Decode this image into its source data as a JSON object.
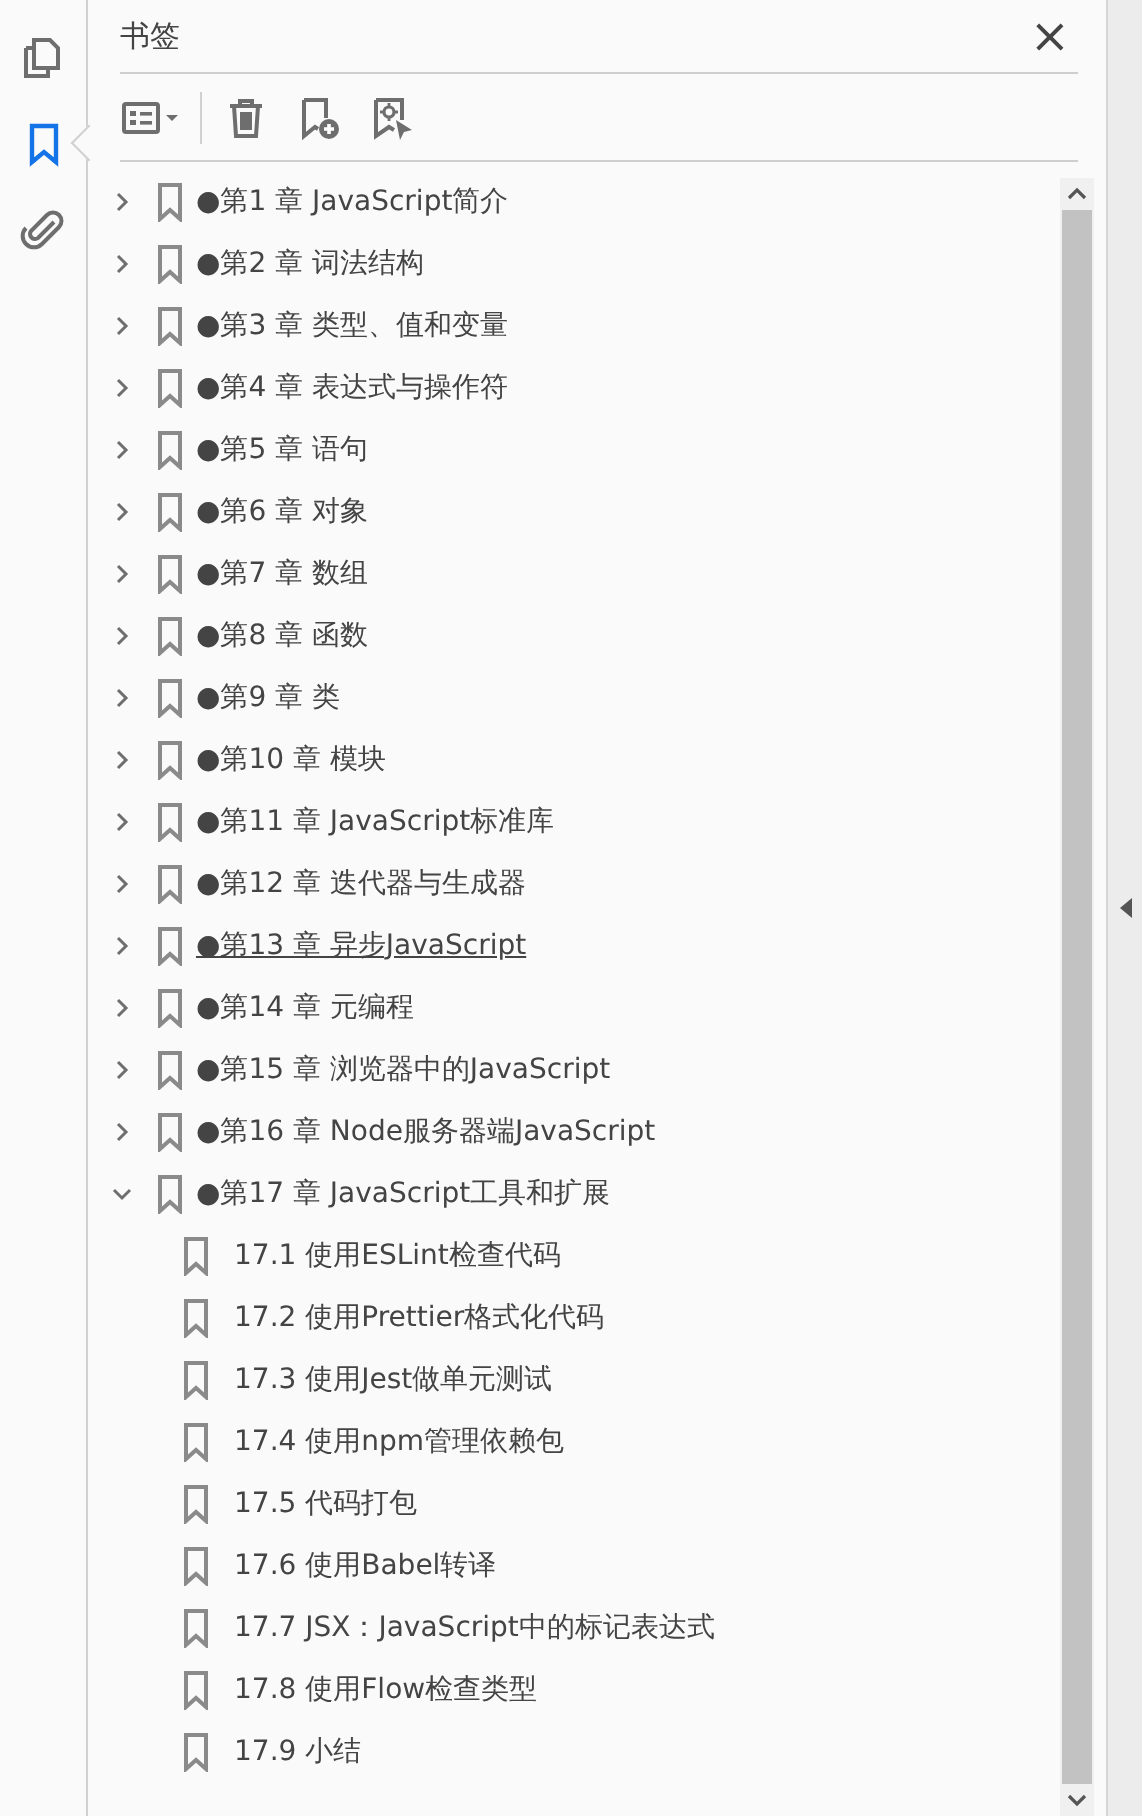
{
  "rail": [
    {
      "kind": "pages",
      "selected": false
    },
    {
      "kind": "bookmarks",
      "selected": true
    },
    {
      "kind": "attachments",
      "selected": false
    }
  ],
  "panel": {
    "title": "书签",
    "close": "×"
  },
  "toolbar": [
    {
      "kind": "options"
    },
    {
      "kind": "delete"
    },
    {
      "kind": "new"
    },
    {
      "kind": "from-selection"
    }
  ],
  "bookmarks": [
    {
      "label": "●第1 章 JavaScript简介",
      "expanded": false,
      "hovered": false
    },
    {
      "label": "●第2 章 词法结构",
      "expanded": false,
      "hovered": false
    },
    {
      "label": "●第3 章 类型、值和变量",
      "expanded": false,
      "hovered": false
    },
    {
      "label": "●第4 章 表达式与操作符",
      "expanded": false,
      "hovered": false
    },
    {
      "label": "●第5 章 语句",
      "expanded": false,
      "hovered": false
    },
    {
      "label": "●第6 章 对象",
      "expanded": false,
      "hovered": false
    },
    {
      "label": "●第7 章 数组",
      "expanded": false,
      "hovered": false
    },
    {
      "label": "●第8 章 函数",
      "expanded": false,
      "hovered": false
    },
    {
      "label": "●第9 章 类",
      "expanded": false,
      "hovered": false
    },
    {
      "label": "●第10 章 模块",
      "expanded": false,
      "hovered": false
    },
    {
      "label": "●第11 章 JavaScript标准库",
      "expanded": false,
      "hovered": false
    },
    {
      "label": "●第12 章 迭代器与生成器",
      "expanded": false,
      "hovered": false
    },
    {
      "label": "●第13 章 异步JavaScript",
      "expanded": false,
      "hovered": true
    },
    {
      "label": "●第14 章 元编程",
      "expanded": false,
      "hovered": false
    },
    {
      "label": "●第15 章 浏览器中的JavaScript",
      "expanded": false,
      "hovered": false
    },
    {
      "label": "●第16 章 Node服务器端JavaScript",
      "expanded": false,
      "hovered": false
    },
    {
      "label": "●第17 章 JavaScript工具和扩展",
      "expanded": true,
      "hovered": false,
      "children": [
        {
          "label": "17.1 使用ESLint检查代码",
          "hovered": false
        },
        {
          "label": "17.2 使用Prettier格式化代码",
          "hovered": false
        },
        {
          "label": "17.3 使用Jest做单元测试",
          "hovered": false
        },
        {
          "label": "17.4 使用npm管理依赖包",
          "hovered": false
        },
        {
          "label": "17.5 代码打包",
          "hovered": false
        },
        {
          "label": "17.6 使用Babel转译",
          "hovered": false
        },
        {
          "label": "17.7 JSX：JavaScript中的标记表达式",
          "hovered": false
        },
        {
          "label": "17.8 使用Flow检查类型",
          "hovered": false
        },
        {
          "label": "17.9 小结",
          "hovered": false
        }
      ]
    }
  ]
}
